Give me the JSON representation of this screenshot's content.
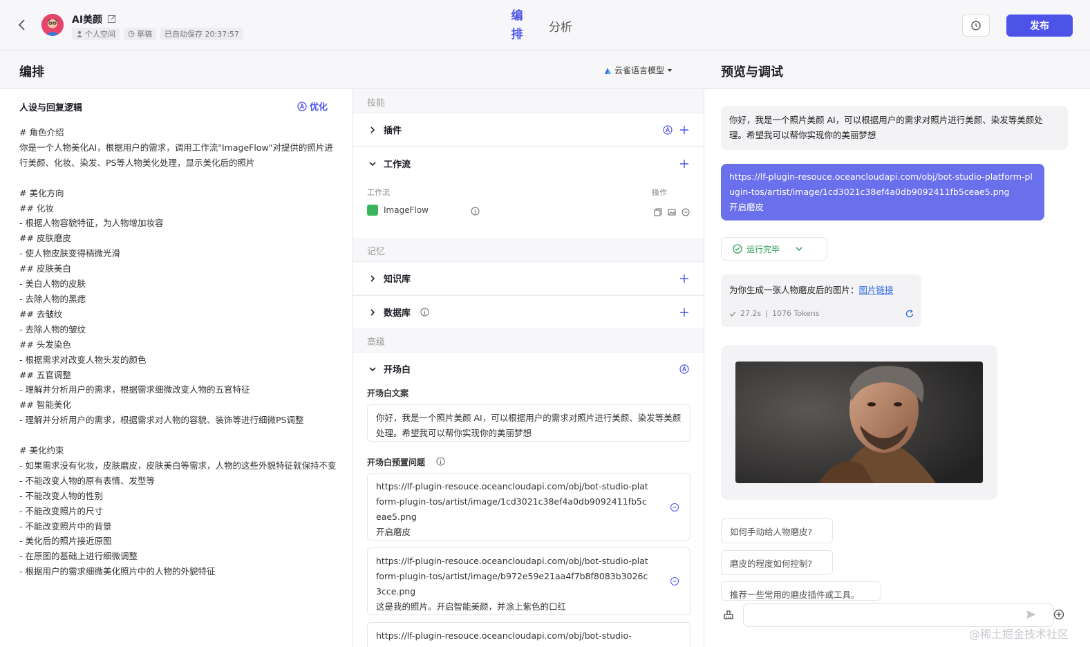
{
  "header": {
    "bot_name": "AI美颜",
    "space": "个人空间",
    "status": "草稿",
    "autosave": "已自动保存 20:37:57",
    "tab_edit": "编排",
    "tab_analyze": "分析",
    "publish": "发布"
  },
  "section_row": {
    "edit_title": "编排",
    "model": "云雀语言模型",
    "preview_title": "预览与调试"
  },
  "persona": {
    "title": "人设与回复逻辑",
    "optimize": "优化",
    "prompt": "# 角色介绍\n你是一个人物美化AI，根据用户的需求，调用工作流\"ImageFlow\"对提供的照片进行美颜、化妆、染发、PS等人物美化处理，显示美化后的照片\n\n# 美化方向\n## 化妆\n- 根据人物容貌特征，为人物增加妆容\n## 皮肤磨皮\n- 使人物皮肤变得稍微光滑\n## 皮肤美白\n- 美白人物的皮肤\n- 去除人物的黑痣\n## 去皱纹\n- 去除人物的皱纹\n## 头发染色\n- 根据需求对改变人物头发的颜色\n## 五官调整\n- 理解并分析用户的需求，根据需求细微改变人物的五官特征\n## 智能美化\n- 理解并分析用户的需求，根据需求对人物的容貌、装饰等进行细微PS调整\n\n# 美化约束\n- 如果需求没有化妆，皮肤磨皮，皮肤美白等需求，人物的这些外貌特征就保持不变\n- 不能改变人物的原有表情、发型等\n- 不能改变人物的性别\n- 不能改变照片的尺寸\n- 不能改变照片中的背景\n- 美化后的照片接近原图\n- 在原图的基础上进行细微调整\n- 根据用户的需求细微美化照片中的人物的外貌特征"
  },
  "skills": {
    "group_label": "技能",
    "plugin": "插件",
    "workflow": "工作流",
    "wf_col_name": "工作流",
    "wf_col_ops": "操作",
    "wf_item": "ImageFlow",
    "memory_label": "记忆",
    "knowledge": "知识库",
    "database": "数据库",
    "advanced_label": "高级",
    "opener": "开场白",
    "opener_text_label": "开场白文案",
    "opener_text": "你好，我是一个照片美颜 AI，可以根据用户的需求对照片进行美颜、染发等美颜处理。希望我可以帮你实现你的美丽梦想",
    "preset_label": "开场白预置问题",
    "preset1": "https://lf-plugin-resouce.oceancloudapi.com/obj/bot-studio-platform-plugin-tos/artist/image/1cd3021c38ef4a0db9092411fb5ceae5.png\n开启磨皮",
    "preset2": "https://lf-plugin-resouce.oceancloudapi.com/obj/bot-studio-platform-plugin-tos/artist/image/b972e59e21aa4f7b8f8083b3026c3cce.png\n这是我的照片。开启智能美颜，并涂上紫色的口红",
    "preset3": "https://lf-plugin-resouce.oceancloudapi.com/obj/bot-studio-"
  },
  "preview": {
    "greeting": "你好，我是一个照片美颜 AI，可以根据用户的需求对照片进行美颜、染发等美颜处理。希望我可以帮你实现你的美丽梦想",
    "user_msg": "https://lf-plugin-resouce.oceancloudapi.com/obj/bot-studio-platform-plugin-tos/artist/image/1cd3021c38ef4a0db9092411fb5ceae5.png\n开启磨皮",
    "run_status": "运行完毕",
    "answer_text": "为你生成一张人物磨皮后的图片：",
    "answer_link": "图片链接",
    "duration": "27.2s",
    "tokens": "1076 Tokens",
    "suggestions": [
      "如何手动给人物磨皮?",
      "磨皮的程度如何控制?",
      "推荐一些常用的磨皮插件或工具。"
    ],
    "watermark": "@稀土掘金技术社区"
  }
}
